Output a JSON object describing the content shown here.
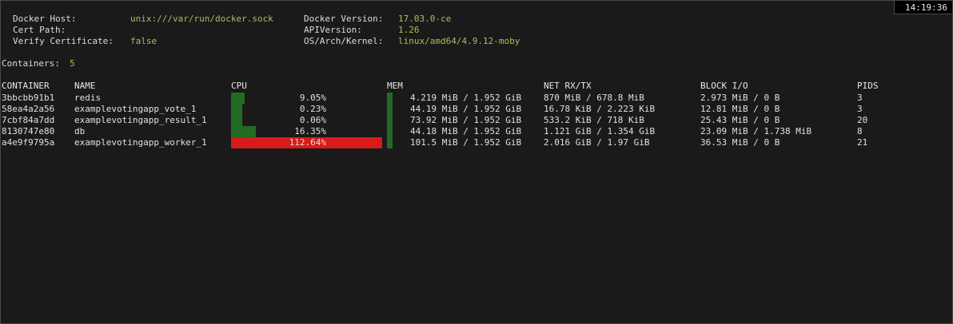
{
  "clock": "14:19:36",
  "header": {
    "docker_host_label": "Docker Host:",
    "docker_host_value": "unix:///var/run/docker.sock",
    "cert_path_label": "Cert Path:",
    "cert_path_value": "",
    "verify_cert_label": "Verify Certificate:",
    "verify_cert_value": "false",
    "docker_version_label": "Docker Version:",
    "docker_version_value": "17.03.0-ce",
    "api_version_label": "APIVersion:",
    "api_version_value": "1.26",
    "os_arch_label": "OS/Arch/Kernel:",
    "os_arch_value": "linux/amd64/4.9.12-moby"
  },
  "containers_label": "Containers:",
  "containers_count": "5",
  "columns": {
    "container": "CONTAINER",
    "name": "NAME",
    "cpu": "CPU",
    "mem": "MEM",
    "net": "NET RX/TX",
    "block": "BLOCK I/O",
    "pids": "PIDS"
  },
  "rows": [
    {
      "container": "3bbcbb91b1",
      "name": "redis",
      "cpu_pct": "9.05%",
      "cpu_value": 9.05,
      "mem": "4.219 MiB / 1.952 GiB",
      "mem_fraction": 0.002,
      "net": "870 MiB / 678.8 MiB",
      "block": "2.973 MiB / 0 B",
      "pids": "3"
    },
    {
      "container": "58ea4a2a56",
      "name": "examplevotingapp_vote_1",
      "cpu_pct": "0.23%",
      "cpu_value": 0.23,
      "mem": "44.19 MiB / 1.952 GiB",
      "mem_fraction": 0.022,
      "net": "16.78 KiB / 2.223 KiB",
      "block": "12.81 MiB / 0 B",
      "pids": "3"
    },
    {
      "container": "7cbf84a7dd",
      "name": "examplevotingapp_result_1",
      "cpu_pct": "0.06%",
      "cpu_value": 0.06,
      "mem": "73.92 MiB / 1.952 GiB",
      "mem_fraction": 0.037,
      "net": "533.2 KiB / 718 KiB",
      "block": "25.43 MiB / 0 B",
      "pids": "20"
    },
    {
      "container": "8130747e80",
      "name": "db",
      "cpu_pct": "16.35%",
      "cpu_value": 16.35,
      "mem": "44.18 MiB / 1.952 GiB",
      "mem_fraction": 0.022,
      "net": "1.121 GiB / 1.354 GiB",
      "block": "23.09 MiB / 1.738 MiB",
      "pids": "8"
    },
    {
      "container": "a4e9f9795a",
      "name": "examplevotingapp_worker_1",
      "cpu_pct": "112.64%",
      "cpu_value": 112.64,
      "mem": "101.5 MiB / 1.952 GiB",
      "mem_fraction": 0.051,
      "net": "2.016 GiB / 1.97 GiB",
      "block": "36.53 MiB / 0 B",
      "pids": "21"
    }
  ],
  "colors": {
    "cpu_normal": "#236b23",
    "cpu_over": "#d81a1a",
    "header_value": "#b7b85b"
  }
}
